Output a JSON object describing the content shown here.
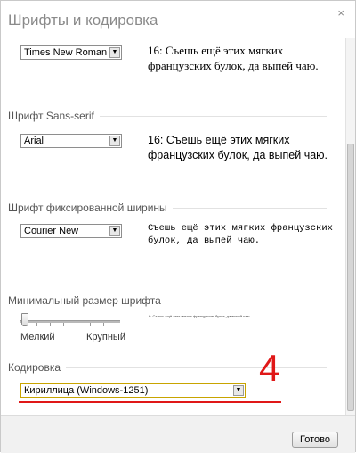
{
  "dialog": {
    "title": "Шрифты и кодировка",
    "close_glyph": "×"
  },
  "serif": {
    "font_value": "Times New Roman",
    "sample": "16: Съешь ещё этих мягких французских булок, да выпей чаю."
  },
  "sans": {
    "section_label": "Шрифт Sans-serif",
    "font_value": "Arial",
    "sample": "16: Съешь ещё этих мягких французских булок, да выпей чаю."
  },
  "fixed": {
    "section_label": "Шрифт фиксированной ширины",
    "font_value": "Courier New",
    "sample": "Съешь ещё этих мягких французских булок, да выпей чаю."
  },
  "min_size": {
    "section_label": "Минимальный размер шрифта",
    "sample": "6: Съешь ещё этих мягких французских булок, да выпей чаю.",
    "min_label": "Мелкий",
    "max_label": "Крупный",
    "slider_level": 0.0
  },
  "encoding": {
    "section_label": "Кодировка",
    "value": "Кириллица (Windows-1251)",
    "annotation": "4",
    "annotation_color": "#e01818"
  },
  "footer": {
    "done_label": "Готово"
  },
  "icons": {
    "dropdown_arrow": "▼"
  }
}
